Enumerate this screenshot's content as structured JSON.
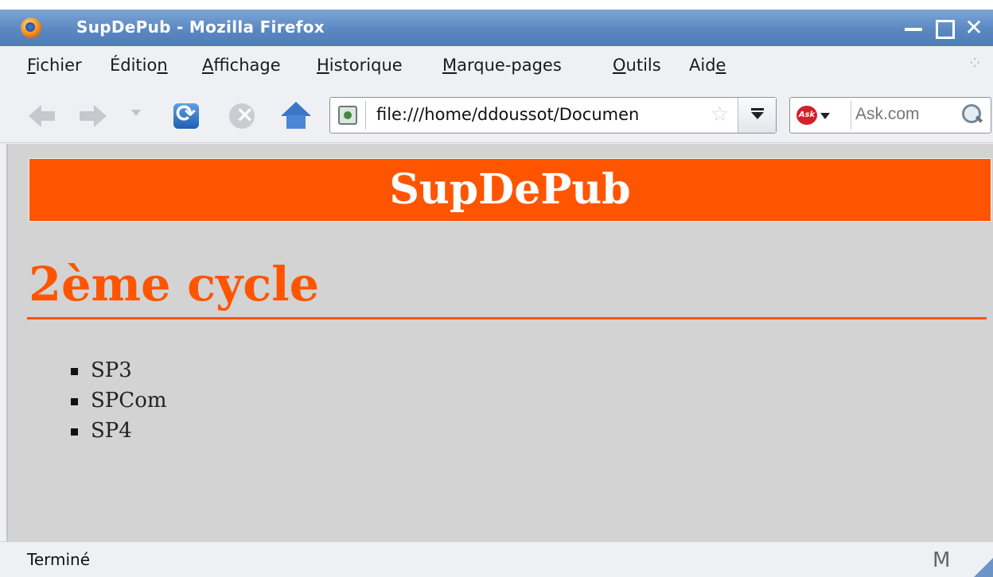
{
  "window": {
    "title": "SupDePub - Mozilla Firefox",
    "close_glyph": "✕"
  },
  "menu": {
    "items": [
      {
        "pre": "",
        "key": "F",
        "post": "ichier"
      },
      {
        "pre": "Éditio",
        "key": "n",
        "post": ""
      },
      {
        "pre": "",
        "key": "A",
        "post": "ffichage"
      },
      {
        "pre": "",
        "key": "H",
        "post": "istorique"
      },
      {
        "pre": "",
        "key": "M",
        "post": "arque-pages"
      },
      {
        "pre": "",
        "key": "O",
        "post": "utils"
      },
      {
        "pre": "Aid",
        "key": "e",
        "post": ""
      }
    ]
  },
  "navbar": {
    "url": "file:///home/ddoussot/Documen",
    "search_placeholder": "Ask.com",
    "search_engine": "Ask"
  },
  "page": {
    "banner": "SupDePub",
    "heading": "2ème cycle",
    "list": [
      "SP3",
      "SPCom",
      "SP4"
    ]
  },
  "status": {
    "text": "Terminé",
    "mail_icon": "M"
  },
  "colors": {
    "accent": "#ff5500",
    "content_bg": "#d3d3d3",
    "titlebar": "#5b88c2"
  }
}
